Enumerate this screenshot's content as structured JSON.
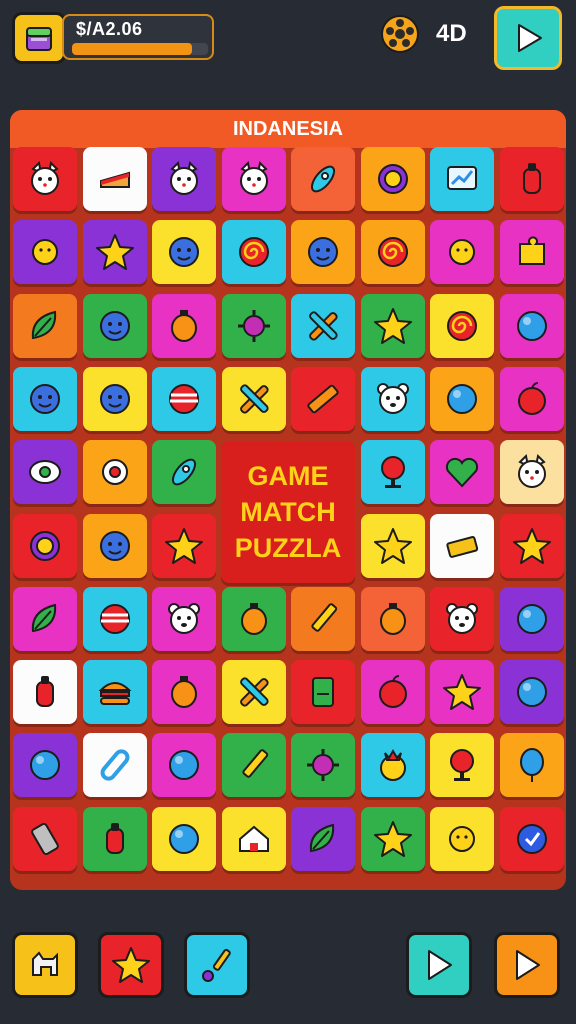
{
  "header": {
    "wallet_label": "$/A2.06",
    "wallet_progress": 0.88,
    "moves": "4D"
  },
  "board": {
    "title": "INDANESIA",
    "center_lines": [
      "GAME",
      "MATCH",
      "PUZZLA"
    ],
    "rows": [
      [
        {
          "color": "#e8242a",
          "icon": "cat-face-icon"
        },
        {
          "color": "#fcfcfc",
          "icon": "cake-slice-icon"
        },
        {
          "color": "#8b32d6",
          "icon": "cat-face-icon"
        },
        {
          "color": "#e832c4",
          "icon": "cat-face-icon"
        },
        {
          "color": "#f46237",
          "icon": "rocket-icon"
        },
        {
          "color": "#fca418",
          "icon": "orb-icon"
        },
        {
          "color": "#2fc9e8",
          "icon": "monitor-icon"
        },
        {
          "color": "#e8242a",
          "icon": "bottle-icon"
        }
      ],
      [
        {
          "color": "#8b32d6",
          "icon": "sun-icon"
        },
        {
          "color": "#8b32d6",
          "icon": "star-icon"
        },
        {
          "color": "#fbe12b",
          "icon": "face-icon"
        },
        {
          "color": "#2fc9e8",
          "icon": "swirl-icon"
        },
        {
          "color": "#fca418",
          "icon": "face-icon"
        },
        {
          "color": "#fca418",
          "icon": "swirl-icon"
        },
        {
          "color": "#e832c4",
          "icon": "sun-icon"
        },
        {
          "color": "#e832c4",
          "icon": "puzzle-icon"
        }
      ],
      [
        {
          "color": "#f47a20",
          "icon": "leaf-icon"
        },
        {
          "color": "#32b04a",
          "icon": "face-icon"
        },
        {
          "color": "#e832c4",
          "icon": "lantern-icon"
        },
        {
          "color": "#32b04a",
          "icon": "virus-icon"
        },
        {
          "color": "#2fc9e8",
          "icon": "cross-icon"
        },
        {
          "color": "#32b04a",
          "icon": "star-icon"
        },
        {
          "color": "#fbe12b",
          "icon": "swirl-icon"
        },
        {
          "color": "#e832c4",
          "icon": "ball-icon"
        }
      ],
      [
        {
          "color": "#2fc9e8",
          "icon": "face-icon"
        },
        {
          "color": "#fbe12b",
          "icon": "face-icon"
        },
        {
          "color": "#2fc9e8",
          "icon": "striped-ball-icon"
        },
        {
          "color": "#fbe12b",
          "icon": "cross-icon"
        },
        {
          "color": "#e8242a",
          "icon": "ruler-icon"
        },
        {
          "color": "#2fc9e8",
          "icon": "bear-face-icon"
        },
        {
          "color": "#fca418",
          "icon": "ball-icon"
        },
        {
          "color": "#e832c4",
          "icon": "apple-icon"
        }
      ],
      [
        {
          "color": "#8b32d6",
          "icon": "eye-icon"
        },
        {
          "color": "#fca418",
          "icon": "gear-icon"
        },
        {
          "color": "#32b04a",
          "icon": "rocket-icon"
        },
        {
          "color": "",
          "icon": ""
        },
        {
          "color": "",
          "icon": ""
        },
        {
          "color": "#2fc9e8",
          "icon": "pin-icon"
        },
        {
          "color": "#e832c4",
          "icon": "heart-icon"
        },
        {
          "color": "#fbe0a0",
          "icon": "cat-face-icon"
        }
      ],
      [
        {
          "color": "#e8242a",
          "icon": "orb-icon"
        },
        {
          "color": "#fca418",
          "icon": "face-icon"
        },
        {
          "color": "#e8242a",
          "icon": "star-icon"
        },
        {
          "color": "",
          "icon": ""
        },
        {
          "color": "",
          "icon": ""
        },
        {
          "color": "#fbe12b",
          "icon": "star-icon"
        },
        {
          "color": "#fcfcfc",
          "icon": "bar-icon"
        },
        {
          "color": "#e8242a",
          "icon": "star-icon"
        }
      ],
      [
        {
          "color": "#e832c4",
          "icon": "leaf-icon"
        },
        {
          "color": "#2fc9e8",
          "icon": "striped-ball-icon"
        },
        {
          "color": "#e832c4",
          "icon": "bear-face-icon"
        },
        {
          "color": "#32b04a",
          "icon": "lantern-icon"
        },
        {
          "color": "#f47a20",
          "icon": "pencil-icon"
        },
        {
          "color": "#f46237",
          "icon": "lantern-icon"
        },
        {
          "color": "#e8242a",
          "icon": "bear-face-icon"
        },
        {
          "color": "#8b32d6",
          "icon": "ball-icon"
        }
      ],
      [
        {
          "color": "#fcfcfc",
          "icon": "bottle-icon"
        },
        {
          "color": "#2fc9e8",
          "icon": "burger-icon"
        },
        {
          "color": "#e832c4",
          "icon": "lantern-icon"
        },
        {
          "color": "#fbe12b",
          "icon": "cross-icon"
        },
        {
          "color": "#e8242a",
          "icon": "document-icon"
        },
        {
          "color": "#e832c4",
          "icon": "apple-icon"
        },
        {
          "color": "#e832c4",
          "icon": "star-icon"
        },
        {
          "color": "#8b32d6",
          "icon": "ball-icon"
        }
      ],
      [
        {
          "color": "#8b32d6",
          "icon": "ball-icon"
        },
        {
          "color": "#fcfcfc",
          "icon": "paperclip-icon"
        },
        {
          "color": "#e832c4",
          "icon": "ball-icon"
        },
        {
          "color": "#32b04a",
          "icon": "pencil-icon"
        },
        {
          "color": "#32b04a",
          "icon": "virus-icon"
        },
        {
          "color": "#2fc9e8",
          "icon": "crown-face-icon"
        },
        {
          "color": "#fbe12b",
          "icon": "pin-icon"
        },
        {
          "color": "#fca418",
          "icon": "balloon-icon"
        }
      ],
      [
        {
          "color": "#e8242a",
          "icon": "phone-icon"
        },
        {
          "color": "#32b04a",
          "icon": "bottle-icon"
        },
        {
          "color": "#fbe12b",
          "icon": "ball-icon"
        },
        {
          "color": "#fbe12b",
          "icon": "house-icon"
        },
        {
          "color": "#8b32d6",
          "icon": "leaf-icon"
        },
        {
          "color": "#32b04a",
          "icon": "star-icon"
        },
        {
          "color": "#fbe12b",
          "icon": "sun-icon"
        },
        {
          "color": "#e8242a",
          "icon": "badge-icon"
        }
      ]
    ]
  },
  "toolbar": [
    {
      "color": "#f6c21a",
      "icon": "dog-icon"
    },
    {
      "color": "#e8242a",
      "icon": "star-icon"
    },
    {
      "color": "#2fc9e8",
      "icon": "brush-icon"
    },
    {
      "color": "#31cfc2",
      "icon": "play-icon"
    },
    {
      "color": "#f79216",
      "icon": "play-icon"
    }
  ]
}
